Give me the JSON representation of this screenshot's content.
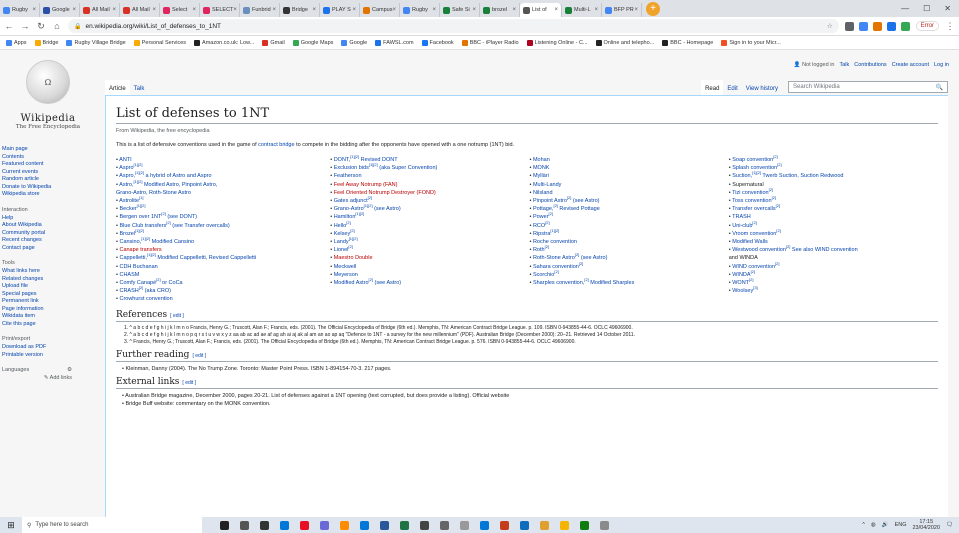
{
  "browser": {
    "tabs": [
      {
        "label": "Rugby",
        "color": "#4285f4"
      },
      {
        "label": "Google",
        "color": "#2a4fa8"
      },
      {
        "label": "All Mail",
        "color": "#d93025"
      },
      {
        "label": "All Mail",
        "color": "#d93025"
      },
      {
        "label": "Select",
        "color": "#e0245e"
      },
      {
        "label": "SELECT",
        "color": "#e0245e"
      },
      {
        "label": "Funbrid",
        "color": "#6c8ebf"
      },
      {
        "label": "Bridge",
        "color": "#333333"
      },
      {
        "label": "PLAY S",
        "color": "#1a73e8"
      },
      {
        "label": "Campus",
        "color": "#e37400"
      },
      {
        "label": "Rugby",
        "color": "#4285f4"
      },
      {
        "label": "Safe Si",
        "color": "#188038"
      },
      {
        "label": "brozel",
        "color": "#188038"
      },
      {
        "label": "List of",
        "color": "#555555"
      },
      {
        "label": "Multi-L",
        "color": "#188038"
      },
      {
        "label": "BFP PR",
        "color": "#4285f4"
      }
    ],
    "url": "en.wikipedia.org/wiki/List_of_defenses_to_1NT",
    "error_label": "Error",
    "bookmarks": [
      {
        "label": "Apps",
        "color": "#4285f4"
      },
      {
        "label": "Bridge",
        "color": "#f9ab00"
      },
      {
        "label": "Rugby Village Bridge",
        "color": "#4285f4"
      },
      {
        "label": "Personal Services",
        "color": "#f9ab00"
      },
      {
        "label": "Amazon.co.uk: Low...",
        "color": "#222222"
      },
      {
        "label": "Gmail",
        "color": "#d93025"
      },
      {
        "label": "Google Maps",
        "color": "#34a853"
      },
      {
        "label": "Google",
        "color": "#4285f4"
      },
      {
        "label": "FAWSL.com",
        "color": "#1a73e8"
      },
      {
        "label": "Facebook",
        "color": "#1877f2"
      },
      {
        "label": "BBC - iPlayer Radio",
        "color": "#e37400"
      },
      {
        "label": "Listening Online - C...",
        "color": "#b00020"
      },
      {
        "label": "Online and telepho...",
        "color": "#222222"
      },
      {
        "label": "BBC - Homepage",
        "color": "#222222"
      },
      {
        "label": "Sign in to your Micr...",
        "color": "#f25022"
      }
    ]
  },
  "wiki": {
    "logo_title": "Wikipedia",
    "logo_sub": "The Free Encyclopedia",
    "nav": [
      "Main page",
      "Contents",
      "Featured content",
      "Current events",
      "Random article",
      "Donate to Wikipedia",
      "Wikipedia store"
    ],
    "interaction_h": "Interaction",
    "interaction": [
      "Help",
      "About Wikipedia",
      "Community portal",
      "Recent changes",
      "Contact page"
    ],
    "tools_h": "Tools",
    "tools": [
      "What links here",
      "Related changes",
      "Upload file",
      "Special pages",
      "Permanent link",
      "Page information",
      "Wikidata item",
      "Cite this page"
    ],
    "print_h": "Print/export",
    "print": [
      "Download as PDF",
      "Printable version"
    ],
    "lang_h": "Languages",
    "add_links": "Add links",
    "not_logged": "Not logged in",
    "user_links": [
      "Talk",
      "Contributions",
      "Create account",
      "Log in"
    ],
    "tab_article": "Article",
    "tab_talk": "Talk",
    "tab_read": "Read",
    "tab_edit": "Edit",
    "tab_history": "View history",
    "search_ph": "Search Wikipedia",
    "title": "List of defenses to 1NT",
    "from": "From Wikipedia, the free encyclopedia",
    "intro_a": "This is a list of defensive conventions used in the game of ",
    "intro_link": "contract bridge",
    "intro_b": " to compete in the bidding after the opponents have opened with a one notrump (1NT) bid.",
    "references_h": "References",
    "further_h": "Further reading",
    "external_h": "External links",
    "edit": "[ edit ]",
    "refs": [
      "1. ^ a b c d e f g h i j k l m n o  Francis, Henry G.; Truscott, Alan F.; Francis, eds. (2001). The Official Encyclopedia of Bridge (6th ed.). Memphis, TN: American Contract Bridge League. p. 109. ISBN 0-943855-44-6. OCLC 49606900.",
      "2. ^ a b c d e f g h i j k l m n o p q r s t u v w x y z aa ab ac ad ae af ag ah ai aj ak al am an ao ap aq  \"Defence to 1NT - a survey for the new millennium\" (PDF). Australian Bridge (December 2000): 20–21. Retrieved 14 October 2011.",
      "3. ^ Francis, Henry G.; Truscott, Alan F.; Francis, eds. (2001). The Official Encyclopedia of Bridge (6th ed.). Memphis, TN: American Contract Bridge League. p. 576. ISBN 0-943855-44-6. OCLC 49606900."
    ],
    "further": [
      "Kleinman, Danny (2004). The No Trump Zone. Toronto: Master Point Press. ISBN 1-894154-70-3. 217 pages."
    ],
    "external": [
      "Australian Bridge magazine, December 2000, pages 20-21. List of defenses against a 1NT opening (text corrupted, but does provide a listing). Official website",
      "Bridge Buff website: commentary on the MONK convention."
    ]
  },
  "cols": [
    [
      "ANTI",
      "Aspro[1][2]",
      "Aspro,[1][2] a hybrid of Astro and Aspro",
      "Astro,[1][2] Modified Astro, Pinpoint Astro,",
      "Grano-Astro, Roth-Stone Astro",
      "Astrolite[1]",
      "Becker[1][2]",
      "Bergen over 1NT[2] (see DONT)",
      "Blue Club transfers[2] (see Transfer overcalls)",
      "Brozel[1][2]",
      "Cansino,[1][2] Modified Cansino",
      "Canape transfers",
      "Cappelletti,[1][2] Modified Cappelletti, Revised Cappelletti",
      "CDH Buchanan",
      "CHASM",
      "Comfy Canapé[2] or CoCa",
      "CRASH[2] (aka CRO)",
      "Crowhurst convention"
    ],
    [
      "DONT,[1][2] Revised DONT",
      "Exclusion bids[1][2] (aka Super Convention)",
      "Featherson",
      "Feel Away Notrump (FAN)",
      "Feel Oriented Notrump Destroyer (FOND)",
      "Gates adjunct[2]",
      "Grano-Astro[1][2] (see Astro)",
      "Hamilton[1][2]",
      "Hello[2]",
      "Kelsey[2]",
      "Landy[1][2]",
      "Lionel[2]",
      "Maestro Double",
      "Meckwell",
      "Meyerson",
      "Modified Astro[2] (see Astro)"
    ],
    [
      "Mohan",
      "MONK",
      "Myllärі",
      "Multi-Landy",
      "Nilsland",
      "Pinpoint Astro[2] (see Astro)",
      "Pottage,[2] Revised Pottage",
      "Power[2]",
      "RCO[2]",
      "Ripstra[1][2]",
      "Roche convention",
      "Roth[2]",
      "Roth-Stone Astro[2] (see Astro)",
      "Sahara convention[2]",
      "Scorchio[2]",
      "Sharples convention,[2] Modified Sharples"
    ],
    [
      "Soap convention[2]",
      "Splash convention[2]",
      "Suction,[1][2] Twerb Suction, Suction Redwood",
      "Supernatural",
      "Tizi convention[2]",
      "Toss convention[2]",
      "Transfer overcalls[2]",
      "TRASH",
      "Uni-club[2]",
      "Vroom convention[2]",
      "Modified Walls",
      "Westwood convention[2] See also WIND convention",
      "and WINDA",
      "WIND convention[2]",
      "WINDA[2]",
      "WONT[2]",
      "Woolsey[3]"
    ]
  ],
  "taskbar": {
    "search_ph": "Type here to search",
    "time": "17:15",
    "date": "23/04/2020",
    "lang": "ENG"
  }
}
